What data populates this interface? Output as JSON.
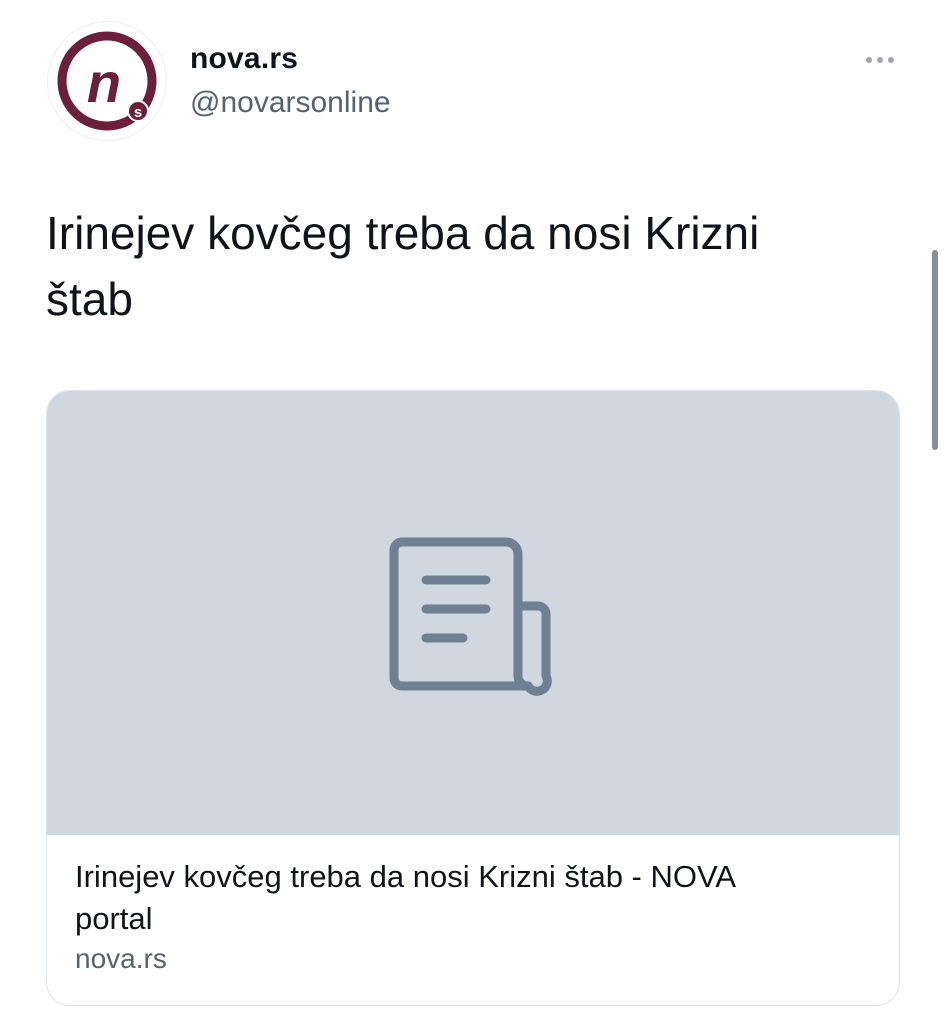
{
  "account": {
    "display_name": "nova.rs",
    "handle": "@novarsonline",
    "avatar_letter": "n",
    "avatar_sub_letter": "s"
  },
  "tweet": {
    "line1": "Irinejev kovčeg treba da nosi Krizni",
    "line2": "štab"
  },
  "link_card": {
    "title_line1": "Irinejev kovčeg treba da nosi Krizni štab - NOVA",
    "title_line2": "portal",
    "domain": "nova.rs",
    "placeholder_icon": "document-icon"
  },
  "icons": {
    "more": "more-horizontal-icon"
  },
  "colors": {
    "brand": "#6b1f3a",
    "text": "#0f1419",
    "secondary": "#536471",
    "card_media_bg": "#cfd8e0",
    "icon_stroke": "#6e8091"
  }
}
